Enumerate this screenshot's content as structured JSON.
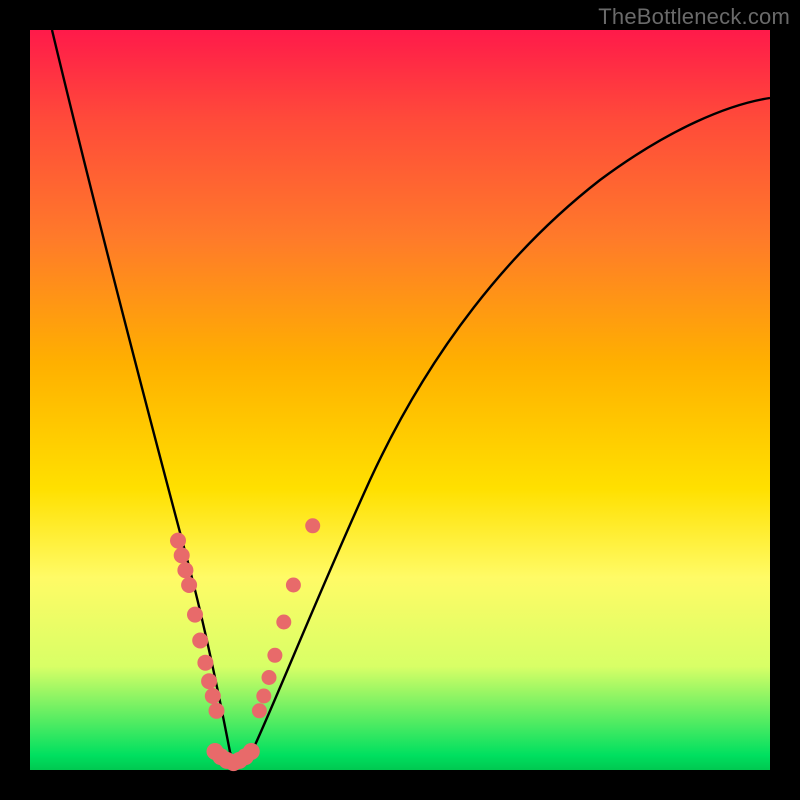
{
  "watermark": "TheBottleneck.com",
  "chart_data": {
    "type": "line",
    "title": "",
    "xlabel": "",
    "ylabel": "",
    "xlim": [
      0,
      1
    ],
    "ylim": [
      0,
      1
    ],
    "grid": false,
    "legend": false,
    "background_gradient_stops": [
      {
        "pos": 0.0,
        "color": "#ff1a4a"
      },
      {
        "pos": 0.12,
        "color": "#ff4a3a"
      },
      {
        "pos": 0.28,
        "color": "#ff7a2a"
      },
      {
        "pos": 0.45,
        "color": "#ffb000"
      },
      {
        "pos": 0.62,
        "color": "#ffe000"
      },
      {
        "pos": 0.74,
        "color": "#fffb66"
      },
      {
        "pos": 0.86,
        "color": "#d8ff66"
      },
      {
        "pos": 0.98,
        "color": "#00e060"
      },
      {
        "pos": 1.0,
        "color": "#00c850"
      }
    ],
    "series": [
      {
        "name": "bottleneck-curve",
        "x": [
          0.03,
          0.08,
          0.13,
          0.17,
          0.21,
          0.24,
          0.26,
          0.27,
          0.28,
          0.3,
          0.33,
          0.37,
          0.43,
          0.5,
          0.58,
          0.68,
          0.8,
          0.92,
          1.0
        ],
        "y": [
          1.0,
          0.78,
          0.56,
          0.38,
          0.22,
          0.1,
          0.04,
          0.01,
          0.02,
          0.06,
          0.14,
          0.28,
          0.44,
          0.58,
          0.7,
          0.79,
          0.85,
          0.88,
          0.89
        ]
      }
    ],
    "markers": {
      "left_branch": [
        {
          "x": 0.2,
          "y": 0.31
        },
        {
          "x": 0.205,
          "y": 0.29
        },
        {
          "x": 0.21,
          "y": 0.27
        },
        {
          "x": 0.215,
          "y": 0.25
        },
        {
          "x": 0.223,
          "y": 0.21
        },
        {
          "x": 0.23,
          "y": 0.175
        },
        {
          "x": 0.237,
          "y": 0.145
        },
        {
          "x": 0.242,
          "y": 0.12
        },
        {
          "x": 0.247,
          "y": 0.1
        },
        {
          "x": 0.252,
          "y": 0.08
        }
      ],
      "bottom": [
        {
          "x": 0.25,
          "y": 0.025
        },
        {
          "x": 0.258,
          "y": 0.018
        },
        {
          "x": 0.266,
          "y": 0.013
        },
        {
          "x": 0.275,
          "y": 0.01
        },
        {
          "x": 0.283,
          "y": 0.013
        },
        {
          "x": 0.291,
          "y": 0.018
        },
        {
          "x": 0.299,
          "y": 0.025
        }
      ],
      "right_branch": [
        {
          "x": 0.31,
          "y": 0.08
        },
        {
          "x": 0.316,
          "y": 0.1
        },
        {
          "x": 0.323,
          "y": 0.125
        },
        {
          "x": 0.331,
          "y": 0.155
        },
        {
          "x": 0.343,
          "y": 0.2
        },
        {
          "x": 0.356,
          "y": 0.25
        },
        {
          "x": 0.382,
          "y": 0.33
        }
      ]
    }
  }
}
